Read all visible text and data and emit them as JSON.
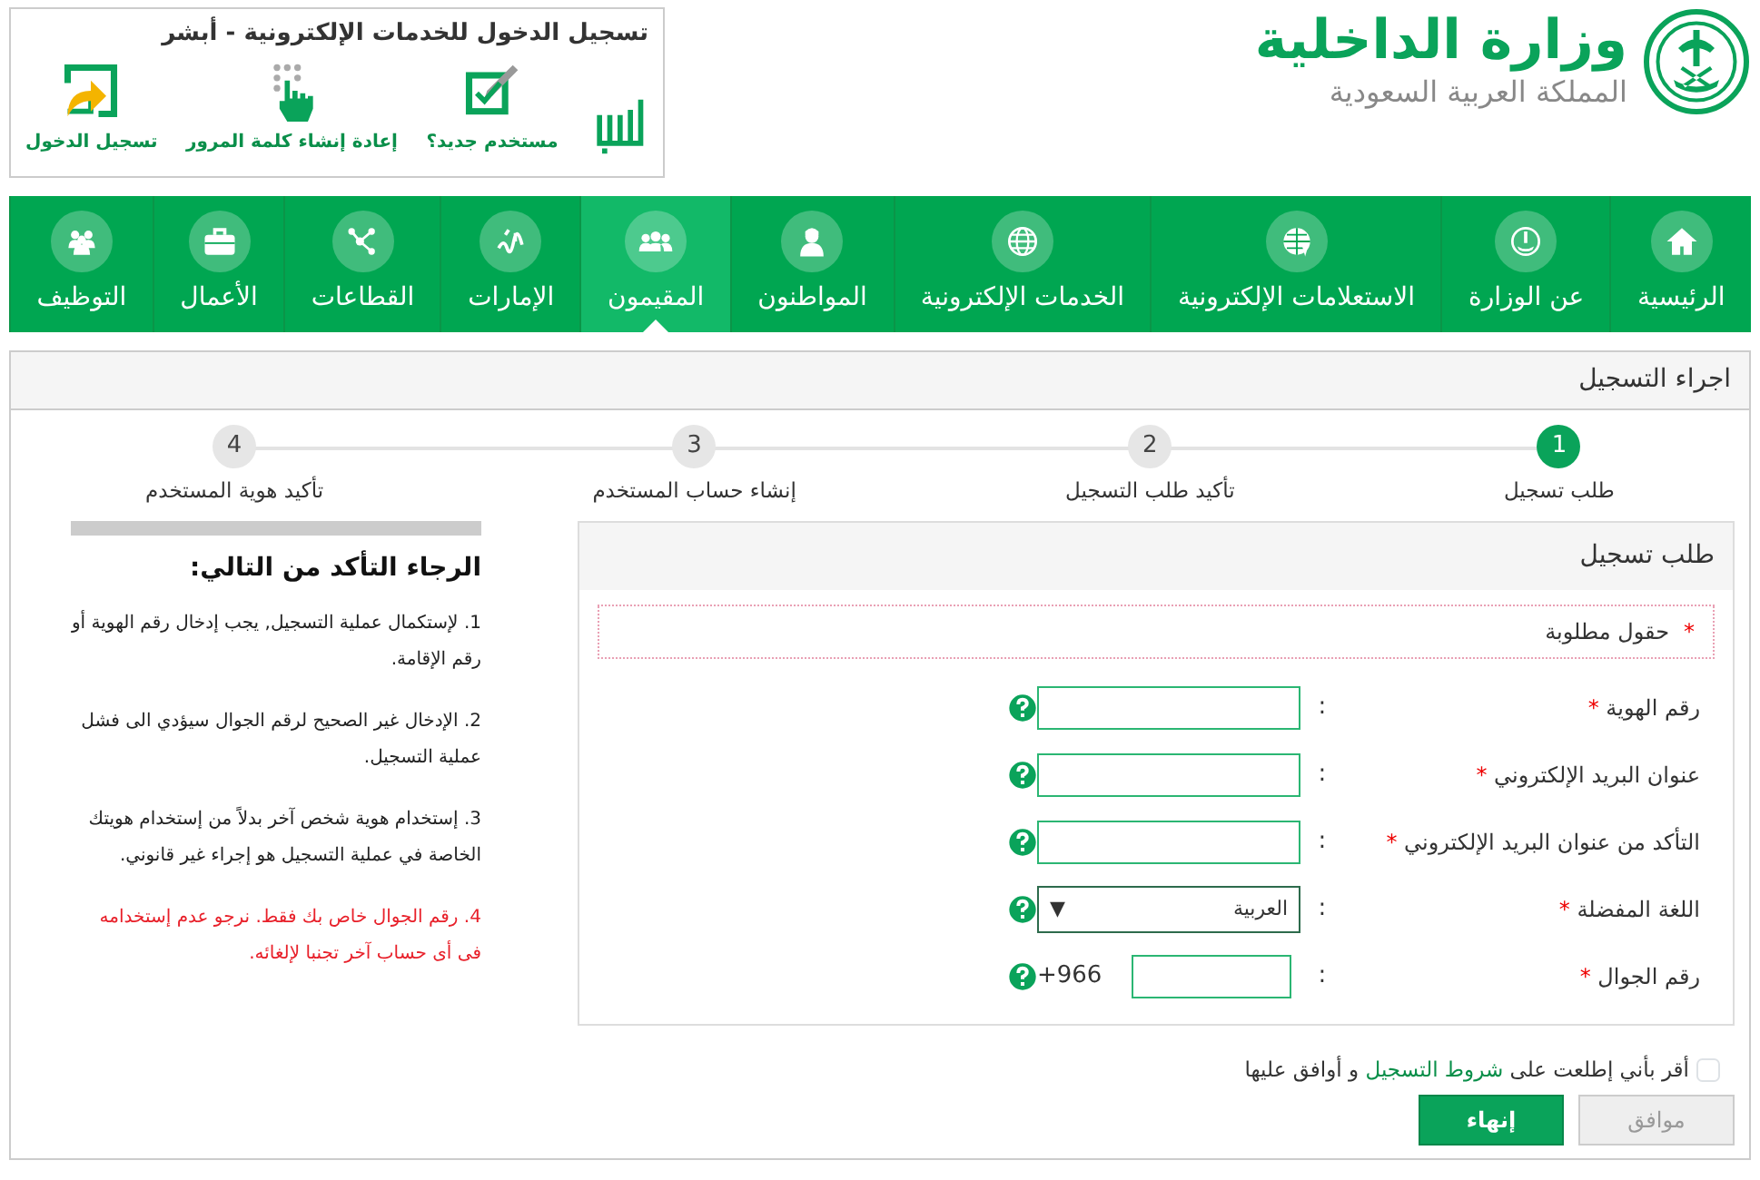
{
  "ministry": {
    "title": "وزارة الداخلية",
    "subtitle": "المملكة العربية السعودية"
  },
  "absher": {
    "title": "تسجيل الدخول للخدمات الإلكترونية - أبشر",
    "links": [
      {
        "label": "مستخدم جديد؟"
      },
      {
        "label": "إعادة إنشاء كلمة المرور"
      },
      {
        "label": "تسجيل الدخول"
      }
    ]
  },
  "nav": [
    {
      "label": "الرئيسية",
      "selected": false
    },
    {
      "label": "عن الوزارة",
      "selected": false
    },
    {
      "label": "الاستعلامات الإلكترونية",
      "selected": false
    },
    {
      "label": "الخدمات الإلكترونية",
      "selected": false
    },
    {
      "label": "المواطنون",
      "selected": false
    },
    {
      "label": "المقيمون",
      "selected": true
    },
    {
      "label": "الإمارات",
      "selected": false
    },
    {
      "label": "القطاعات",
      "selected": false
    },
    {
      "label": "الأعمال",
      "selected": false
    },
    {
      "label": "التوظيف",
      "selected": false
    }
  ],
  "panel_title": "اجراء التسجيل",
  "steps": [
    {
      "number": "1",
      "label": "طلب تسجيل",
      "selected": true
    },
    {
      "number": "2",
      "label": "تأكيد طلب التسجيل",
      "selected": false
    },
    {
      "number": "3",
      "label": "إنشاء حساب المستخدم",
      "selected": false
    },
    {
      "number": "4",
      "label": "تأكيد هوية المستخدم",
      "selected": false
    }
  ],
  "form": {
    "title": "طلب تسجيل",
    "legend": {
      "mark": "*",
      "text": "حقول مطلوبة"
    },
    "separator": ":",
    "fields": [
      {
        "kind": "text",
        "label": "رقم الهوية",
        "asterisk": "*"
      },
      {
        "kind": "text",
        "label": "عنوان البريد الإلكتروني",
        "asterisk": "*"
      },
      {
        "kind": "text",
        "label": "التأكد من عنوان البريد الإلكتروني",
        "asterisk": "*"
      },
      {
        "kind": "select",
        "label": "اللغة المفضلة",
        "asterisk": "*",
        "value": "العربية",
        "arrow": "▼"
      },
      {
        "kind": "phone",
        "label": "رقم الجوال",
        "asterisk": "*",
        "prefix": "+966"
      }
    ]
  },
  "notes": {
    "title": "الرجاء التأكد من التالي:",
    "items": [
      {
        "kind": "note",
        "text": "1. لإستكمال عملية التسجيل, يجب إدخال رقم الهوية أو رقم الإقامة."
      },
      {
        "kind": "note",
        "text": "2. الإدخال غير الصحيح لرقم الجوال سيؤدي الى فشل عملية التسجيل."
      },
      {
        "kind": "note",
        "text": "3. إستخدام هوية شخص آخر بدلاً من إستخدام هويتك الخاصة في عملية التسجيل هو إجراء غير قانوني."
      },
      {
        "kind": "warning",
        "text": "4. رقم الجوال خاص بك فقط. نرجو عدم إستخدامه فى أى حساب آخر تجنبا لإلغائه."
      }
    ]
  },
  "agreement": {
    "checked": false,
    "before": "أقر بأني إطلعت على",
    "link": "شروط التسجيل",
    "after": "و أوافق عليها"
  },
  "buttons": [
    {
      "label": "موافق",
      "disabled": true
    },
    {
      "label": "إنهاء",
      "disabled": false
    }
  ]
}
